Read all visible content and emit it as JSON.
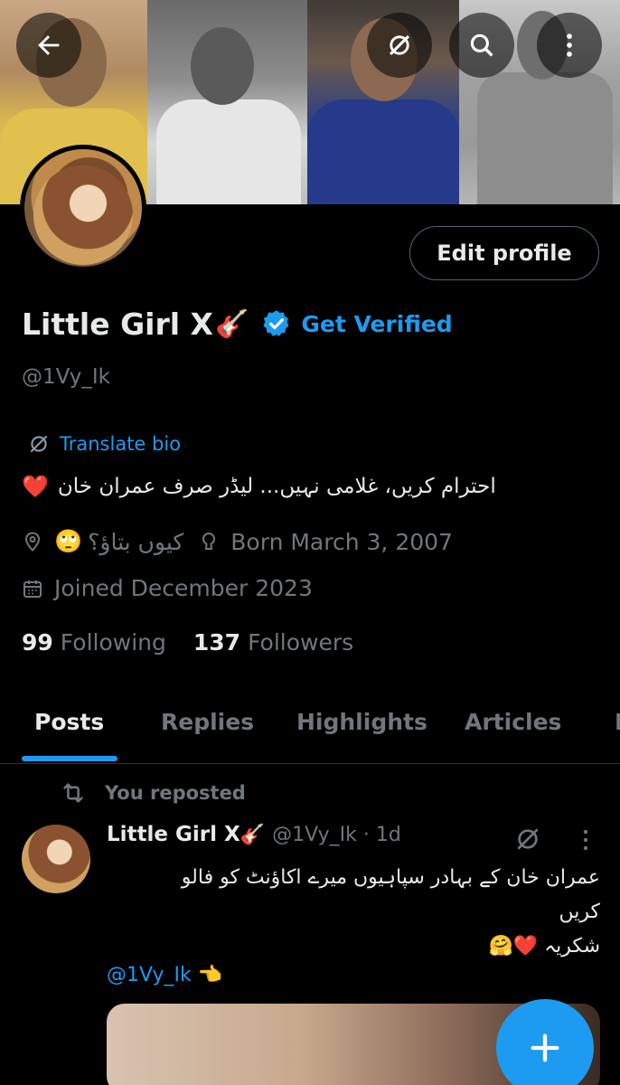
{
  "header": {
    "back_icon": "arrow-left-icon",
    "grok_icon": "grok-icon",
    "search_icon": "search-icon",
    "more_icon": "more-vertical-icon"
  },
  "profile": {
    "display_name": "Little Girl X",
    "name_emoji": "🎸",
    "verify_label": "Get Verified",
    "handle": "@1Vy_Ik",
    "edit_button": "Edit profile",
    "translate_label": "Translate bio",
    "bio": "احترام کریں، غلامی نہیں... لیڈر صرف عمران خان",
    "bio_emoji": "❤️",
    "location": "کیوں بتاؤ؟",
    "location_emoji": "🙄",
    "birthday": "Born March 3, 2007",
    "joined": "Joined December 2023",
    "following_count": "99",
    "following_label": "Following",
    "followers_count": "137",
    "followers_label": "Followers"
  },
  "tabs": [
    {
      "label": "Posts",
      "active": true
    },
    {
      "label": "Replies",
      "active": false
    },
    {
      "label": "Highlights",
      "active": false
    },
    {
      "label": "Articles",
      "active": false
    },
    {
      "label": "M",
      "active": false
    }
  ],
  "post": {
    "repost_label": "You reposted",
    "author_name": "Little Girl X",
    "author_emoji": "🎸",
    "author_meta": "@1Vy_Ik · 1d",
    "text": "عمران خان کے بہادر سپاہیوں میرے اکاؤنٹ کو فالو\nکریں\nشکریہ ❤️🤗",
    "mention": "@1Vy_Ik 👈"
  },
  "colors": {
    "accent": "#1d9bf0",
    "background": "#000000",
    "text_primary": "#e7e9ea",
    "text_secondary": "#71767b"
  },
  "fab": {
    "icon": "plus-icon"
  }
}
